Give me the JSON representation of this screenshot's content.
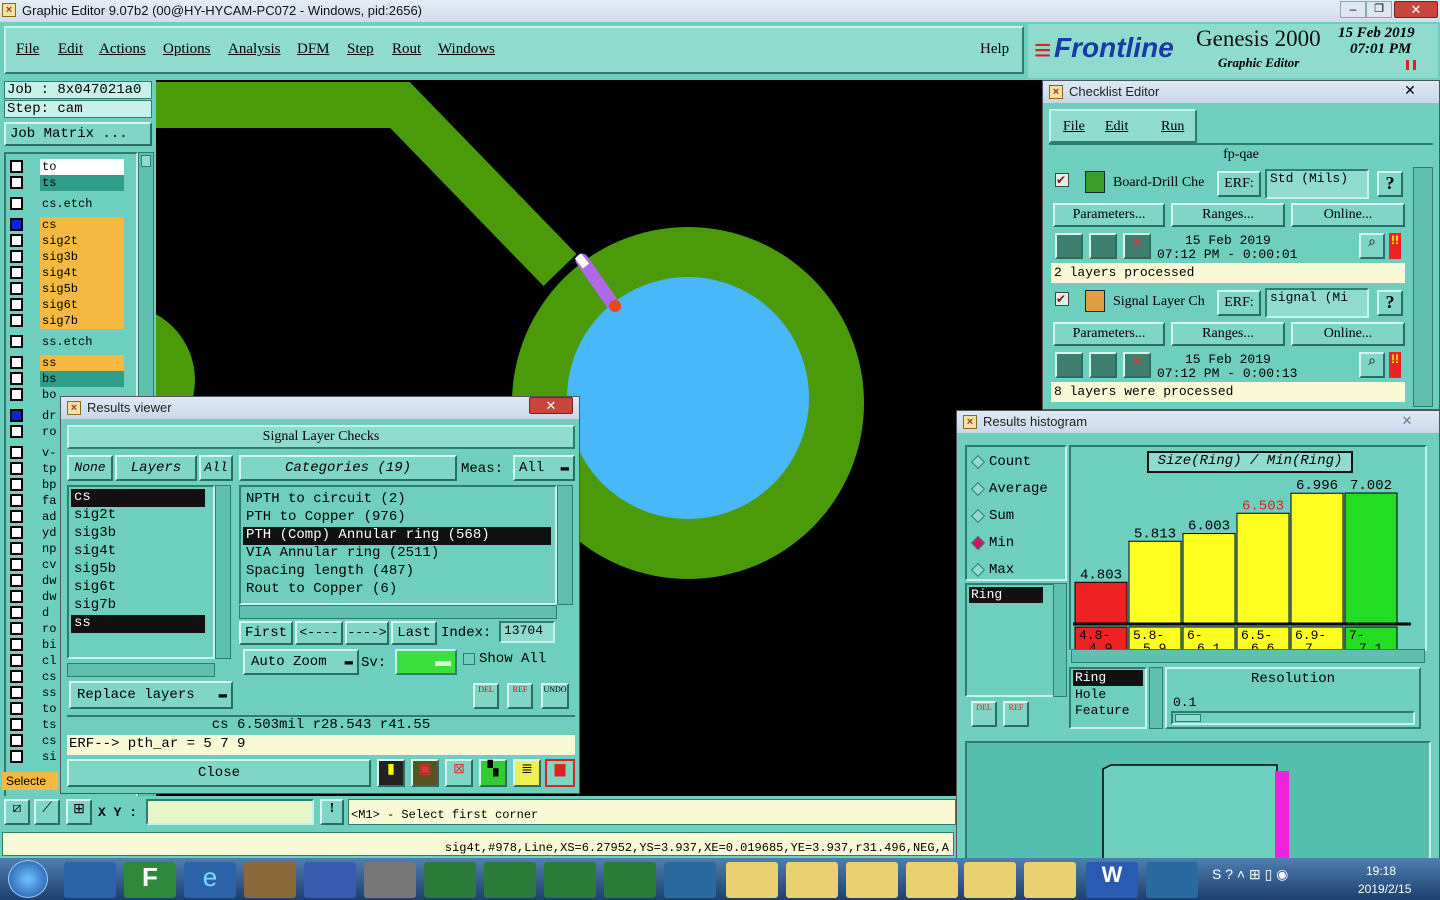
{
  "window": {
    "title": "Graphic Editor 9.07b2 (00@HY-HYCAM-PC072 - Windows, pid:2656)"
  },
  "menu": {
    "items": [
      "File",
      "Edit",
      "Actions",
      "Options",
      "Analysis",
      "DFM",
      "Step",
      "Rout",
      "Windows"
    ],
    "help": "Help"
  },
  "brand": {
    "logo": "Frontline",
    "product": "Genesis 2000",
    "subtitle": "Graphic Editor",
    "date": "15 Feb 2019",
    "time": "07:01 PM"
  },
  "job": {
    "job_label": "Job : 8x047021a0",
    "step_label": "Step: cam",
    "matrix_button": "Job Matrix ..."
  },
  "layers": [
    {
      "name": "to",
      "color": "#ffffff"
    },
    {
      "name": "ts",
      "color": "#2e9e8a"
    },
    {
      "name": "cs.etch",
      "color": "#6ecfbe"
    },
    {
      "name": "cs",
      "color": "#f5b942"
    },
    {
      "name": "sig2t",
      "color": "#f5b942"
    },
    {
      "name": "sig3b",
      "color": "#f5b942"
    },
    {
      "name": "sig4t",
      "color": "#f5b942"
    },
    {
      "name": "sig5b",
      "color": "#f5b942"
    },
    {
      "name": "sig6t",
      "color": "#f5b942"
    },
    {
      "name": "sig7b",
      "color": "#f5b942"
    },
    {
      "name": "ss.etch",
      "color": "#6ecfbe"
    },
    {
      "name": "ss",
      "color": "#f5b942"
    },
    {
      "name": "bs",
      "color": "#2e9e8a"
    },
    {
      "name": "bo",
      "color": "#6ecfbe"
    }
  ],
  "layers_partial": [
    "dr",
    "ro",
    "v-",
    "tp",
    "bp",
    "fa",
    "ad",
    "yd",
    "np",
    "cv",
    "dw",
    "dw",
    "d",
    "ro",
    "bi",
    "cl",
    "cs",
    "ss",
    "to",
    "ts",
    "cs",
    "si"
  ],
  "selected_label": "Selecte",
  "status": {
    "xy_label": "X Y :",
    "prompt": "<M1> - Select first corner",
    "info": "sig4t,#978,Line,XS=6.27952,YS=3.937,XE=0.019685,YE=3.937,r31.496,NEG,A"
  },
  "checklist": {
    "title": "Checklist Editor",
    "menu": [
      "File",
      "Edit",
      "Run"
    ],
    "name": "fp-qae",
    "items": [
      {
        "name": "Board-Drill Che",
        "erf_label": "ERF:",
        "erf": "Std (Mils)",
        "params": "Parameters...",
        "ranges": "Ranges...",
        "online": "Online...",
        "date": "15 Feb 2019",
        "time": "07:12 PM - 0:00:01",
        "status": "2 layers processed"
      },
      {
        "name": "Signal Layer Ch",
        "erf_label": "ERF:",
        "erf": "signal (Mi",
        "params": "Parameters...",
        "ranges": "Ranges...",
        "online": "Online...",
        "date": "15 Feb 2019",
        "time": "07:12 PM - 0:00:13",
        "status": "8 layers were processed"
      }
    ]
  },
  "results_viewer": {
    "title": "Results viewer",
    "header": "Signal Layer Checks",
    "none": "None",
    "layers_btn": "Layers",
    "all": "All",
    "categories_btn": "Categories (19)",
    "meas_label": "Meas:",
    "meas_value": "All",
    "layer_list": [
      "cs",
      "sig2t",
      "sig3b",
      "sig4t",
      "sig5b",
      "sig6t",
      "sig7b",
      "ss"
    ],
    "category_list": [
      "NPTH to circuit (2)",
      "PTH to Copper (976)",
      "PTH (Comp) Annular ring (568)",
      "VIA Annular ring (2511)",
      "Spacing length (487)",
      "Rout to Copper (6)"
    ],
    "first": "First",
    "prev": "<----",
    "next": "---->",
    "last": "Last",
    "index_label": "Index:",
    "index_value": "13704",
    "auto_zoom": "Auto Zoom",
    "sv_label": "Sv:",
    "show_all": "Show All",
    "replace_layers": "Replace layers",
    "del": "DEL",
    "ref": "REF",
    "undo": "UNDO",
    "measure": "cs 6.503mil  r28.543  r41.55",
    "erf_line": "ERF--> pth_ar = 5 7 9",
    "close": "Close"
  },
  "histogram": {
    "title": "Results histogram",
    "mode_options": [
      "Count",
      "Average",
      "Sum",
      "Min",
      "Max"
    ],
    "selected_mode": "Min",
    "heading": "Size(Ring) / Min(Ring)",
    "chart_data": {
      "type": "bar",
      "categories": [
        "4.8-4.9",
        "5.8-5.9",
        "6-6.1",
        "6.5-6.6",
        "6.9-7",
        "7-7.1"
      ],
      "values": [
        4.803,
        5.813,
        6.003,
        6.503,
        6.996,
        7.002
      ],
      "colors": [
        "#ee2222",
        "#ffff22",
        "#ffff22",
        "#ffff22",
        "#ffff22",
        "#22dd22"
      ],
      "highlight_index": 3
    },
    "list": [
      "Ring"
    ],
    "types": [
      "Ring",
      "Hole",
      "Feature"
    ],
    "resolution_label": "Resolution",
    "resolution_value": "0.1",
    "del": "DEL",
    "ref": "REF"
  },
  "taskbar": {
    "time": "19:18",
    "date": "2019/2/15"
  }
}
